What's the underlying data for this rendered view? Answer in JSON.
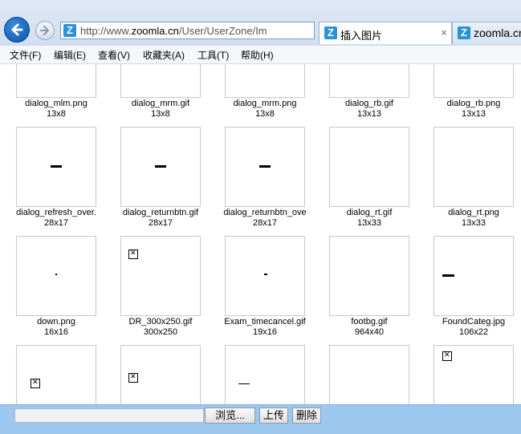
{
  "browser": {
    "url_prefix": "http://www.",
    "url_host": "zoomla.cn",
    "url_path": "/User/UserZone/Im",
    "tabs": [
      {
        "label": "插入图片",
        "close": "×"
      },
      {
        "label": "zoomla.cn"
      }
    ],
    "site_icon_letter": "Z"
  },
  "menu": [
    "文件(F)",
    "编辑(E)",
    "查看(V)",
    "收藏夹(A)",
    "工具(T)",
    "帮助(H)"
  ],
  "files": [
    {
      "name": "dialog_mlm.png",
      "dims": "13x8"
    },
    {
      "name": "dialog_mrm.gif",
      "dims": "13x8"
    },
    {
      "name": "dialog_mrm.png",
      "dims": "13x8"
    },
    {
      "name": "dialog_rb.gif",
      "dims": "13x13"
    },
    {
      "name": "dialog_rb.png",
      "dims": "13x13"
    },
    {
      "name": "dialog_refresh_over.",
      "dims": "28x17"
    },
    {
      "name": "dialog_returnbtn.gif",
      "dims": "28x17"
    },
    {
      "name": "dialog_returnbtn_ove",
      "dims": "28x17"
    },
    {
      "name": "dialog_rt.gif",
      "dims": "13x33"
    },
    {
      "name": "dialog_rt.png",
      "dims": "13x33"
    },
    {
      "name": "down.png",
      "dims": "16x16"
    },
    {
      "name": "DR_300x250.gif",
      "dims": "300x250"
    },
    {
      "name": "Exam_timecancel.gif",
      "dims": "19x16"
    },
    {
      "name": "footbg.gif",
      "dims": "964x40"
    },
    {
      "name": "FoundCateg.jpg",
      "dims": "106x22"
    }
  ],
  "upload": {
    "browse_label": "浏览...",
    "upload_label": "上传",
    "delete_label": "删除"
  },
  "colors": {
    "upload_bar": "#9cc8ef",
    "site_icon": "#2a93d5"
  }
}
